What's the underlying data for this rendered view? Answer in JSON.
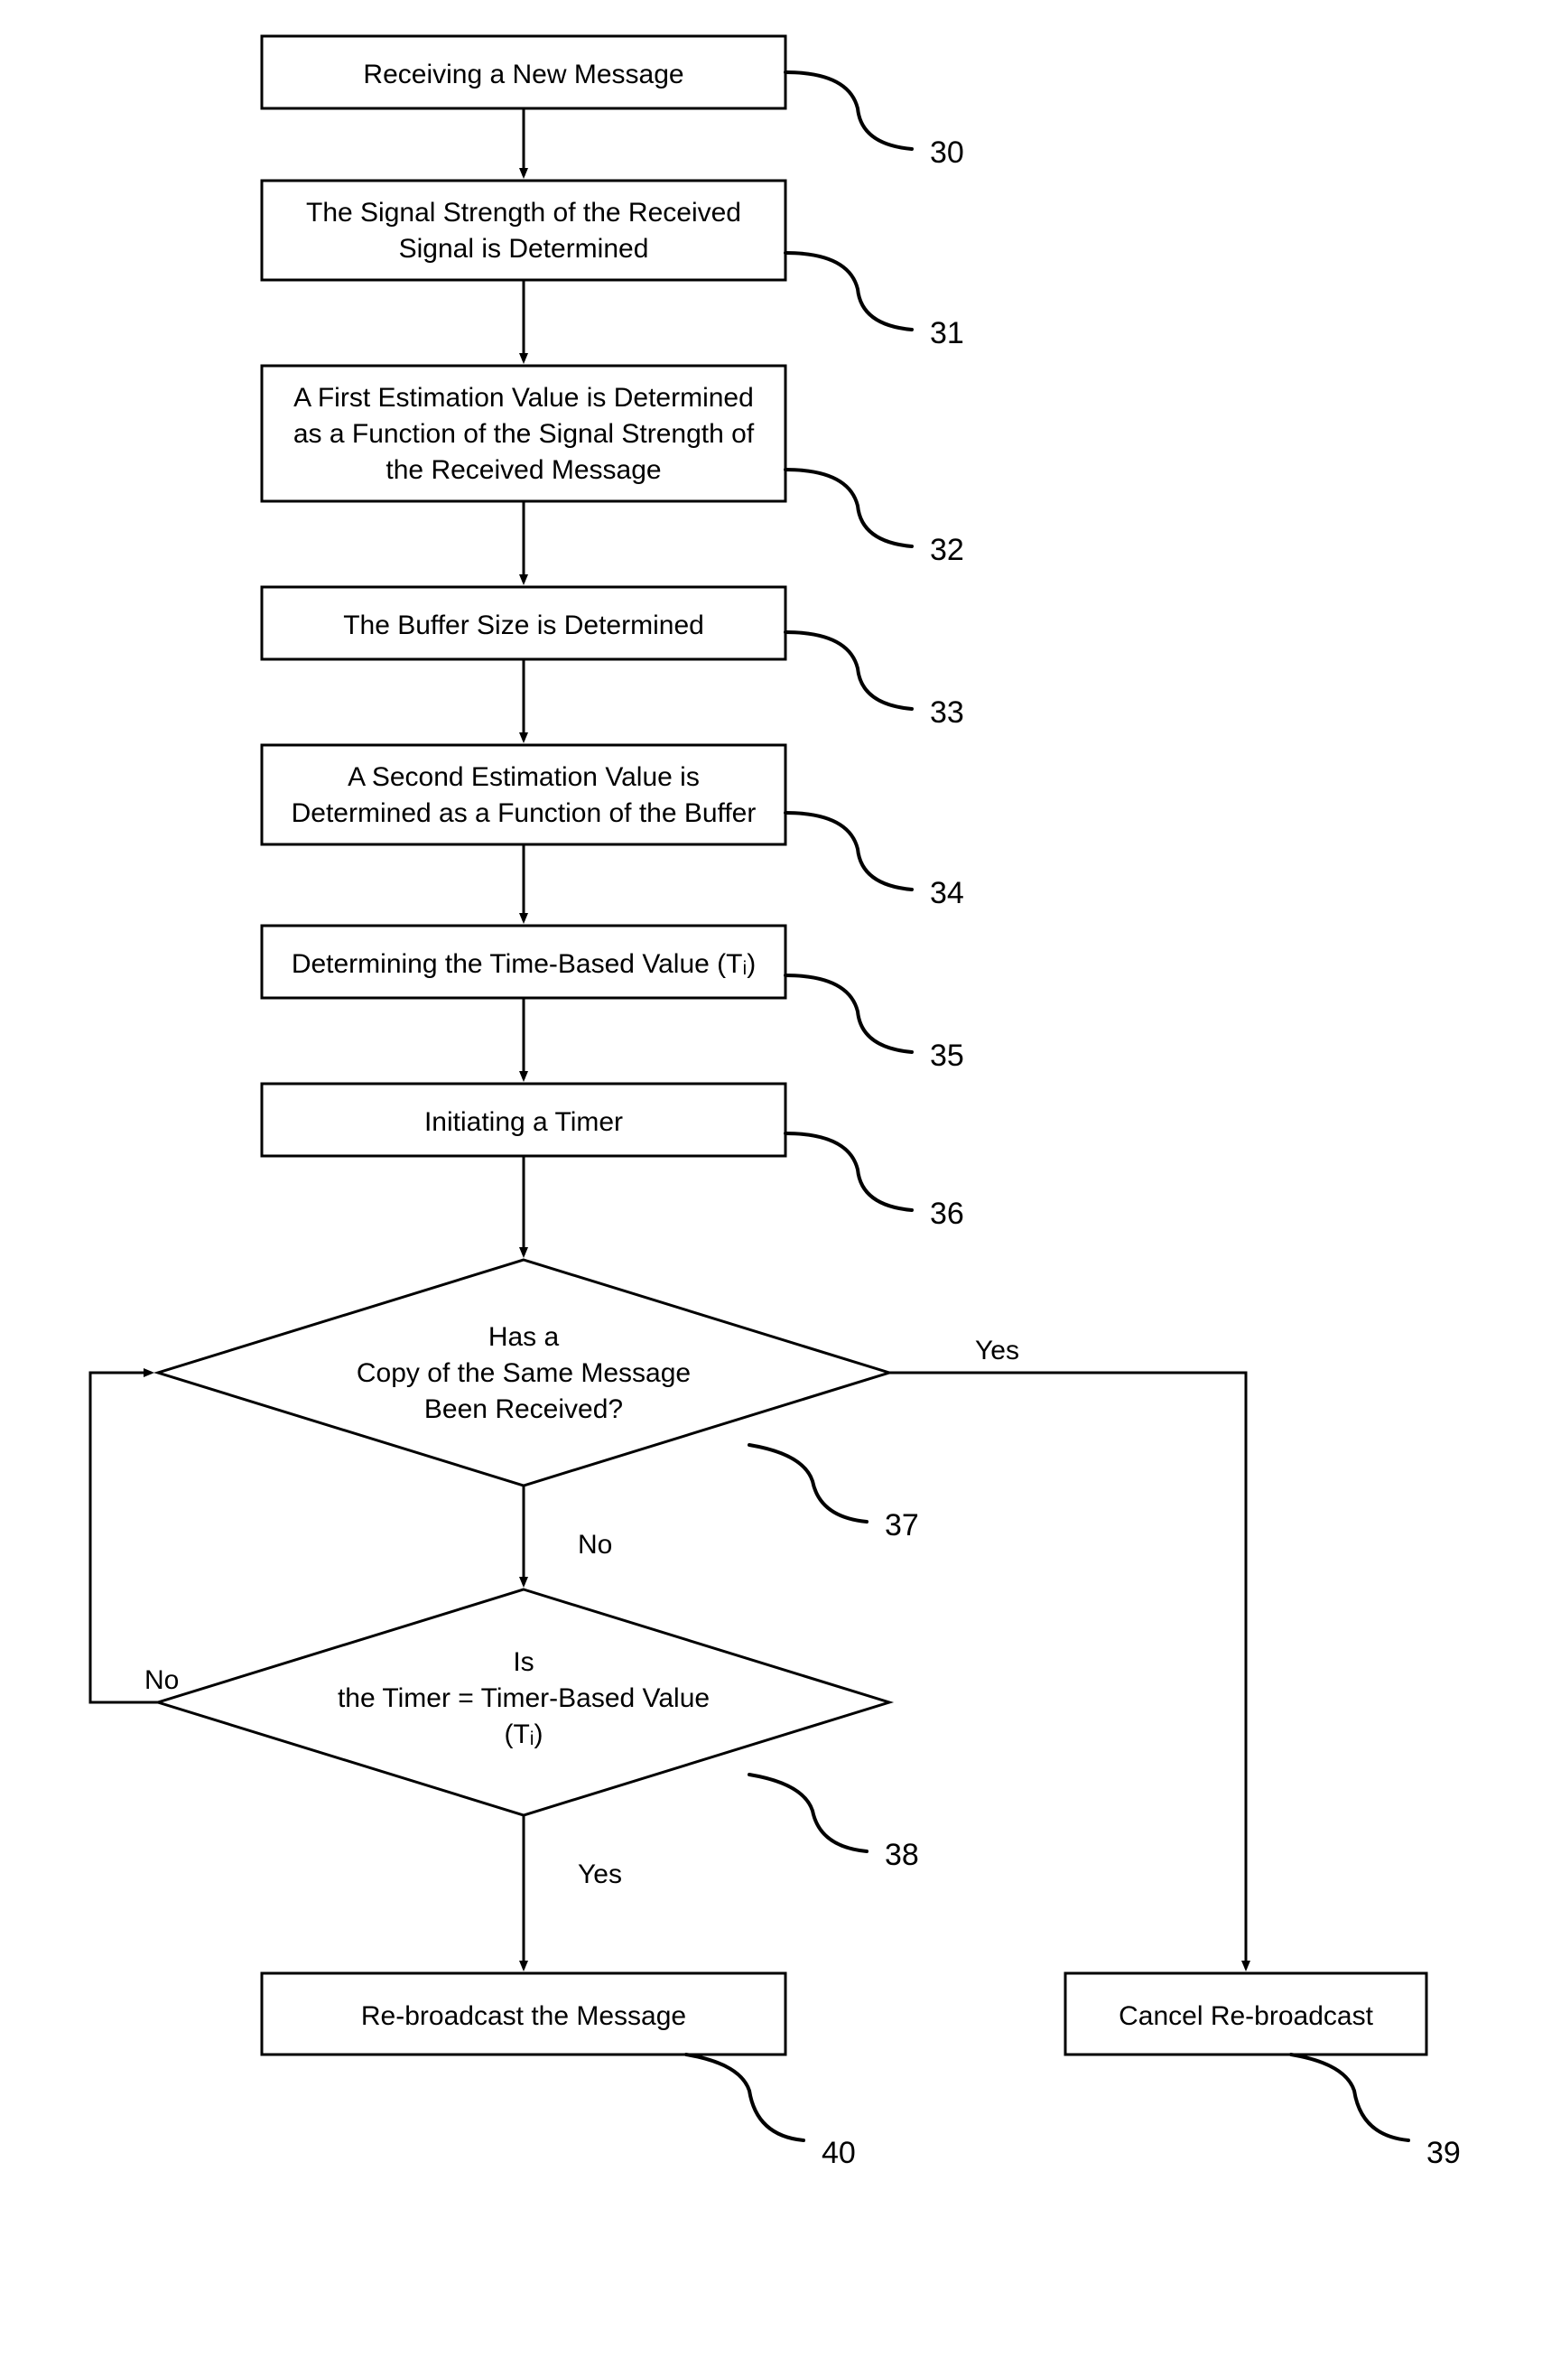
{
  "steps": {
    "s30": {
      "num": "30",
      "lines": [
        "Receiving a New Message"
      ]
    },
    "s31": {
      "num": "31",
      "lines": [
        "The Signal Strength of the Received",
        "Signal is Determined"
      ]
    },
    "s32": {
      "num": "32",
      "lines": [
        "A First Estimation Value is Determined",
        "as a Function of the Signal Strength of",
        "the Received Message"
      ]
    },
    "s33": {
      "num": "33",
      "lines": [
        "The  Buffer Size is Determined"
      ]
    },
    "s34": {
      "num": "34",
      "lines": [
        "A Second Estimation Value is",
        "Determined as a Function of the Buffer"
      ]
    },
    "s35": {
      "num": "35",
      "lines": [
        "Determining the Time-Based Value (Tᵢ)"
      ]
    },
    "s36": {
      "num": "36",
      "lines": [
        "Initiating a Timer"
      ]
    },
    "s37": {
      "num": "37",
      "lines": [
        "Has a",
        "Copy of the Same Message",
        "Been Received?"
      ]
    },
    "s38": {
      "num": "38",
      "lines": [
        "Is",
        "the Timer = Timer-Based Value",
        "(Tᵢ)"
      ]
    },
    "s39": {
      "num": "39",
      "lines": [
        "Cancel Re-broadcast"
      ]
    },
    "s40": {
      "num": "40",
      "lines": [
        "Re-broadcast the Message"
      ]
    }
  },
  "edges": {
    "yes": "Yes",
    "no": "No"
  }
}
